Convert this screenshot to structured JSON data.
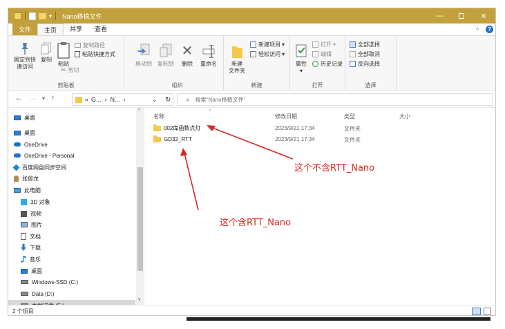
{
  "window": {
    "title": "Nano移植文件",
    "minimize_icon": "minimize-icon",
    "maximize_icon": "maximize-icon",
    "close_icon": "close-icon"
  },
  "ribbon_tabs": [
    "文件",
    "主页",
    "共享",
    "查看"
  ],
  "ribbon": {
    "clipboard": {
      "pin_label_1": "固定到快",
      "pin_label_2": "速访问",
      "copy": "复制",
      "paste": "粘贴",
      "copy_path": "复制路径",
      "paste_shortcut": "粘贴快捷方式",
      "cut": "剪切",
      "group_label": "剪贴板"
    },
    "organize": {
      "move_to": "移动到",
      "copy_to": "复制到",
      "delete": "删除",
      "rename": "重命名",
      "group_label": "组织"
    },
    "new": {
      "new_folder_1": "新建",
      "new_folder_2": "文件夹",
      "new_item": "新建项目",
      "easy_access": "轻松访问",
      "group_label": "新建"
    },
    "open": {
      "properties": "属性",
      "open": "打开",
      "edit": "编辑",
      "history": "历史记录",
      "group_label": "打开"
    },
    "select": {
      "select_all": "全部选择",
      "select_none": "全部取消",
      "invert": "反向选择",
      "group_label": "选择"
    }
  },
  "address": {
    "path_prefix": "«",
    "path": [
      "G...",
      "N..."
    ],
    "search_placeholder": "搜索\"Nano移植文件\""
  },
  "nav": [
    {
      "label": "桌面",
      "icon": "desktop-icon"
    },
    {
      "label": "桌面",
      "icon": "desktop-icon"
    },
    {
      "label": "OneDrive",
      "icon": "cloud-icon"
    },
    {
      "label": "OneDrive - Personal",
      "icon": "cloud-icon"
    },
    {
      "label": "百度网盘同步空间",
      "icon": "sync-icon"
    },
    {
      "label": "张俊龙",
      "icon": "user-icon"
    },
    {
      "label": "此电脑",
      "icon": "computer-icon"
    },
    {
      "label": "3D 对象",
      "icon": "cube-icon"
    },
    {
      "label": "视频",
      "icon": "video-icon"
    },
    {
      "label": "图片",
      "icon": "picture-icon"
    },
    {
      "label": "文档",
      "icon": "document-icon"
    },
    {
      "label": "下载",
      "icon": "download-icon"
    },
    {
      "label": "音乐",
      "icon": "music-icon"
    },
    {
      "label": "桌面",
      "icon": "desktop-icon"
    },
    {
      "label": "Windows-SSD (C:)",
      "icon": "drive-icon"
    },
    {
      "label": "Data (D:)",
      "icon": "drive-icon"
    },
    {
      "label": "本地磁盘 (E:)",
      "icon": "drive-icon"
    }
  ],
  "columns": {
    "name": "名称",
    "modified": "修改日期",
    "type": "类型",
    "size": "大小"
  },
  "files": [
    {
      "name": "002库函数点灯",
      "modified": "2023/9/21 17:34",
      "type": "文件夹"
    },
    {
      "name": "GD32_RTT",
      "modified": "2023/9/21 17:34",
      "type": "文件夹"
    }
  ],
  "annotations": {
    "no_rtt_nano": "这个不含RTT_Nano",
    "has_rtt_nano": "这个含RTT_Nano",
    "color": "#d9271e"
  },
  "status": {
    "count": "2 个项目"
  }
}
